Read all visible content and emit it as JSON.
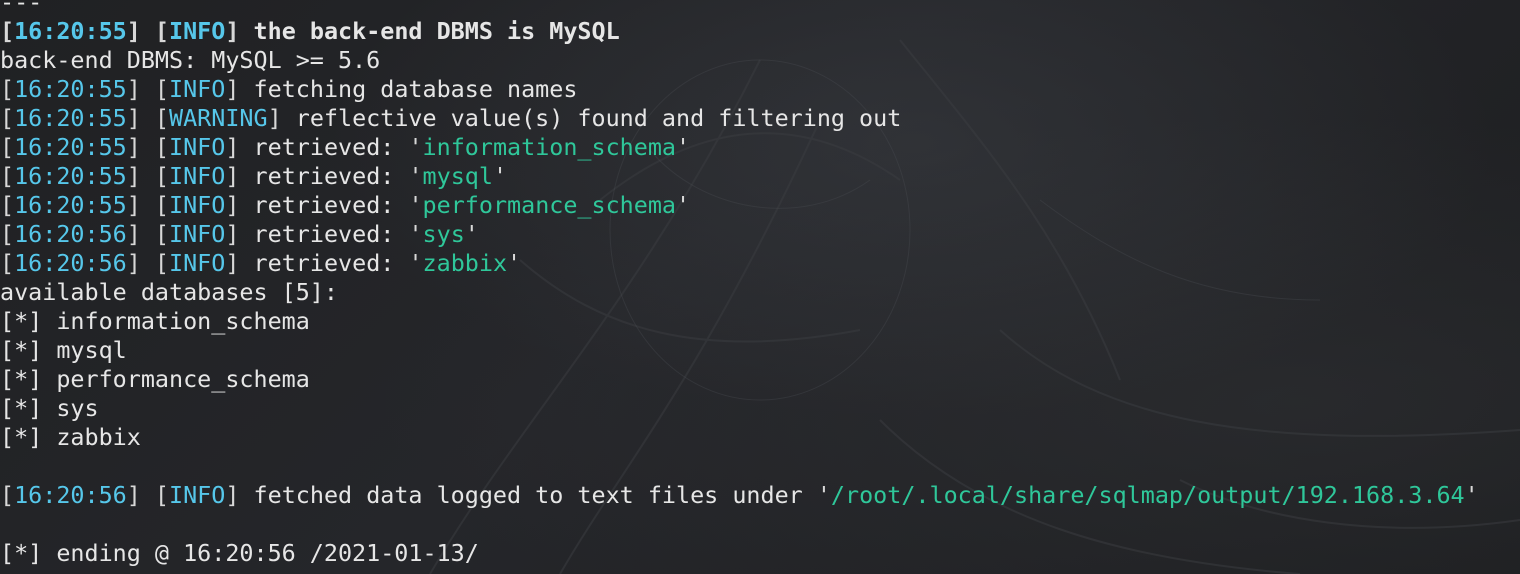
{
  "terminal": {
    "separator": "---",
    "lines": [
      {
        "kind": "log",
        "bold": true,
        "ts": "16:20:55",
        "level": "INFO",
        "text": "the back-end DBMS is MySQL"
      },
      {
        "kind": "plain",
        "text": "back-end DBMS: MySQL >= 5.6"
      },
      {
        "kind": "log",
        "ts": "16:20:55",
        "level": "INFO",
        "text": "fetching database names"
      },
      {
        "kind": "log",
        "ts": "16:20:55",
        "level": "WARNING",
        "text": "reflective value(s) found and filtering out"
      },
      {
        "kind": "log",
        "ts": "16:20:55",
        "level": "INFO",
        "text": "retrieved: ",
        "value": "information_schema"
      },
      {
        "kind": "log",
        "ts": "16:20:55",
        "level": "INFO",
        "text": "retrieved: ",
        "value": "mysql"
      },
      {
        "kind": "log",
        "ts": "16:20:55",
        "level": "INFO",
        "text": "retrieved: ",
        "value": "performance_schema"
      },
      {
        "kind": "log",
        "ts": "16:20:56",
        "level": "INFO",
        "text": "retrieved: ",
        "value": "sys"
      },
      {
        "kind": "log",
        "ts": "16:20:56",
        "level": "INFO",
        "text": "retrieved: ",
        "value": "zabbix"
      },
      {
        "kind": "plain",
        "text": "available databases [5]:"
      },
      {
        "kind": "plain",
        "text": "[*] information_schema"
      },
      {
        "kind": "plain",
        "text": "[*] mysql"
      },
      {
        "kind": "plain",
        "text": "[*] performance_schema"
      },
      {
        "kind": "plain",
        "text": "[*] sys"
      },
      {
        "kind": "plain",
        "text": "[*] zabbix"
      },
      {
        "kind": "blank",
        "text": ""
      },
      {
        "kind": "log",
        "ts": "16:20:56",
        "level": "INFO",
        "text": "fetched data logged to text files under ",
        "value": "/root/.local/share/sqlmap/output/192.168.3.64"
      },
      {
        "kind": "blank",
        "text": ""
      },
      {
        "kind": "plain",
        "text": "[*] ending @ 16:20:56 /2021-01-13/"
      }
    ]
  },
  "colors": {
    "background": "#1e1f21",
    "text": "#e6e6e6",
    "timestamp": "#56c7ea",
    "level": "#56c7ea",
    "string_value": "#2fc79a"
  }
}
